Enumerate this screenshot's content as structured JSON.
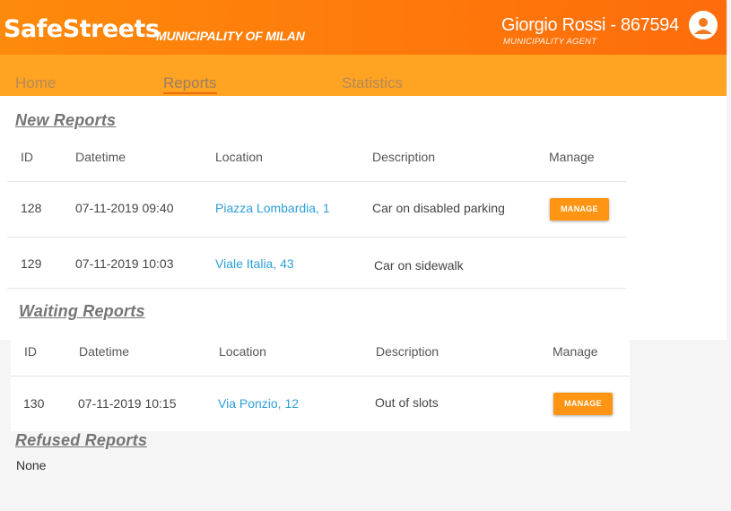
{
  "header": {
    "brand": "SafeStreets",
    "subtitle": "MUNICIPALITY OF MILAN",
    "user_name": "Giorgio Rossi - 867594",
    "user_role": "MUNICIPALITY AGENT",
    "avatar_icon": "account-circle-icon"
  },
  "nav": {
    "items": [
      {
        "label": "Home"
      },
      {
        "label": "Reports",
        "active": true
      },
      {
        "label": "Statistics"
      }
    ]
  },
  "columns": {
    "id": "ID",
    "datetime": "Datetime",
    "location": "Location",
    "description": "Description",
    "manage": "Manage"
  },
  "new_reports": {
    "title": "New Reports",
    "rows": [
      {
        "id": "128",
        "datetime": "07-11-2019 09:40",
        "location": "Piazza Lombardia, 1",
        "description": "Car on disabled parking",
        "manage": "MANAGE"
      },
      {
        "id": "129",
        "datetime": "07-11-2019 10:03",
        "location": "Viale Italia, 43",
        "description": "Car on sidewalk"
      }
    ]
  },
  "waiting_reports": {
    "title": "Waiting Reports",
    "rows": [
      {
        "id": "130",
        "datetime": "07-11-2019 10:15",
        "location": "Via Ponzio, 12",
        "description": "Out of slots",
        "manage": "MANAGE"
      }
    ]
  },
  "refused_reports": {
    "title": "Refused Reports",
    "empty_text": "None"
  },
  "colors": {
    "header_start": "#fe8a0b",
    "header_end": "#fe6c0b",
    "nav_bg": "#ffa322",
    "button": "#ff9512",
    "link": "#2d9fd9"
  }
}
